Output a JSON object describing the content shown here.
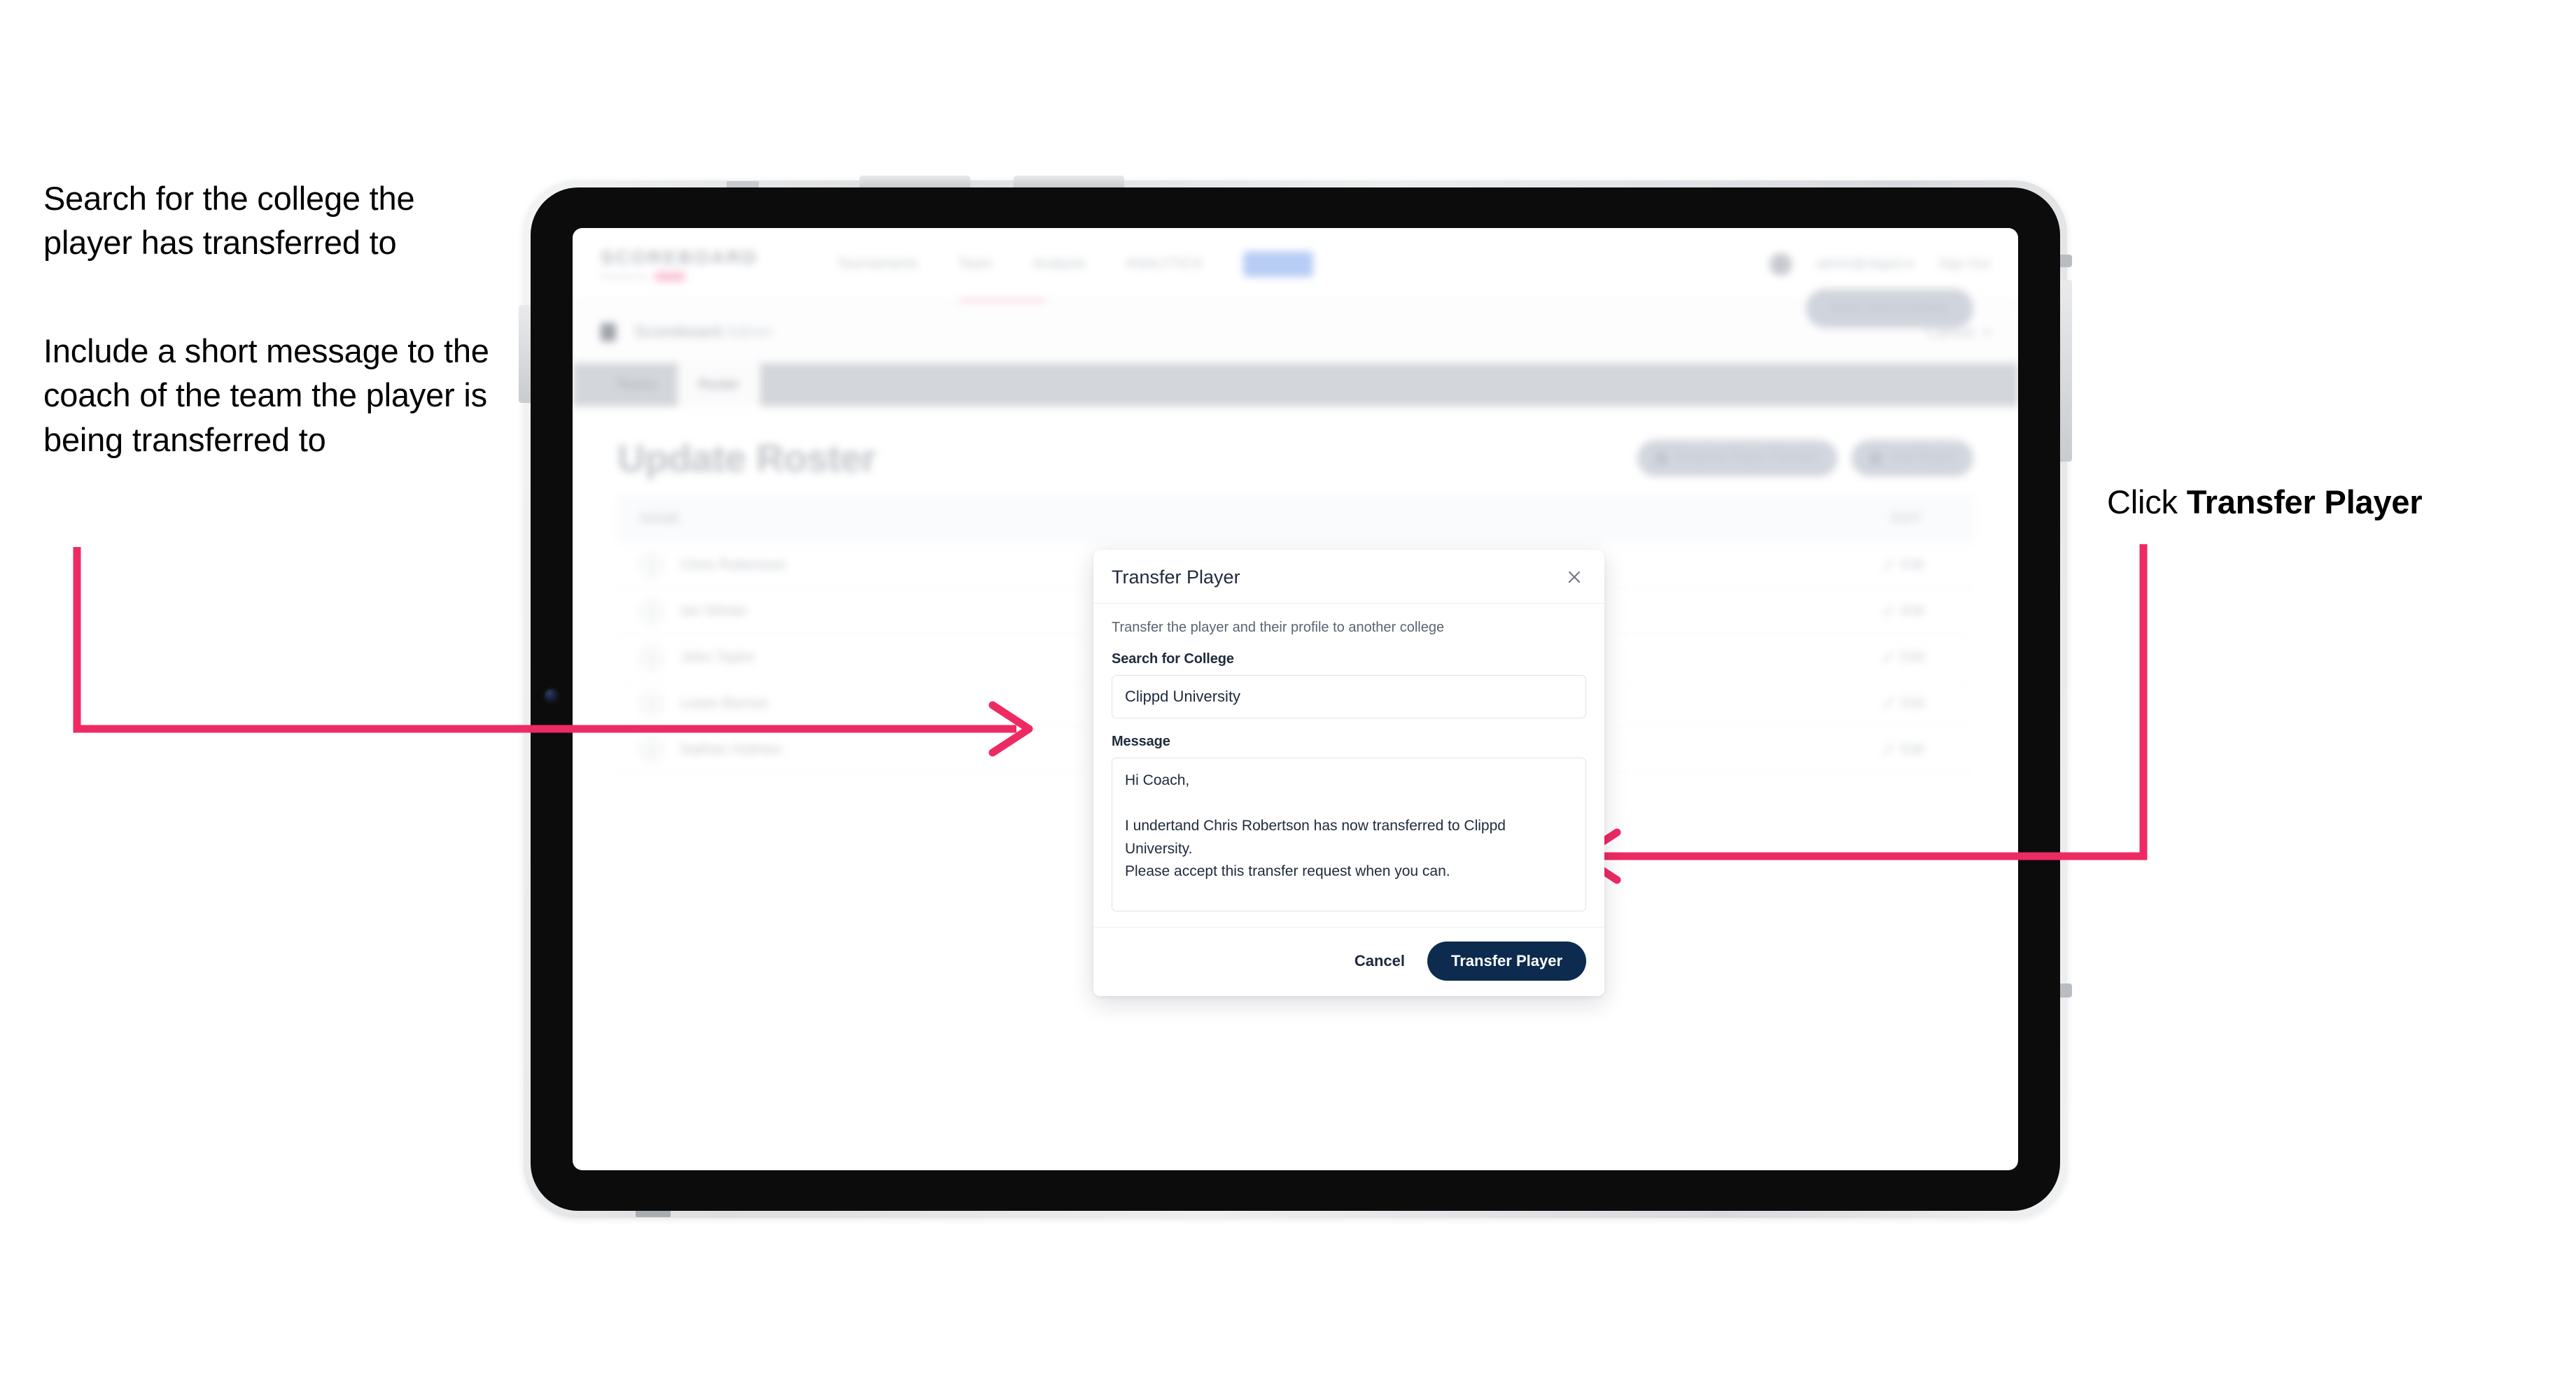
{
  "annotations": {
    "left_top": "Search for the college the player has transferred to",
    "left_bottom": "Include a short message to the coach of the team the player is being transferred to",
    "right_prefix": "Click ",
    "right_strong": "Transfer Player",
    "accent_color": "#ee2a63"
  },
  "app": {
    "brand": {
      "name": "SCOREBOARD",
      "sub": "Powered by"
    },
    "nav": [
      {
        "label": "Tournaments"
      },
      {
        "label": "Team"
      },
      {
        "label": "Analysis"
      },
      {
        "label": "ANALYTICS"
      },
      {
        "label": "Admin"
      }
    ],
    "header_right": {
      "account": "admin@clippd.io",
      "signout": "Sign Out"
    },
    "breadcrumb": {
      "title": "Scoreboard",
      "suffix": "Admin",
      "cancel": "Cancel",
      "chevron": "▾"
    },
    "tabs": [
      {
        "label": "Teams",
        "active": false
      },
      {
        "label": "Roster",
        "active": true
      }
    ],
    "page_title": "Update Roster",
    "page_actions": [
      {
        "label": "Request Player Transfer"
      },
      {
        "label": "Add Player"
      }
    ],
    "roster": {
      "columns": {
        "name": "NAME",
        "edit": "EDIT"
      },
      "rows": [
        {
          "name": "Chris Robertson",
          "action": "Edit"
        },
        {
          "name": "Ian Winter",
          "action": "Edit"
        },
        {
          "name": "John Taylor",
          "action": "Edit"
        },
        {
          "name": "Lewis Barnes",
          "action": "Edit"
        },
        {
          "name": "Nathan Holmes",
          "action": "Edit"
        }
      ]
    },
    "save_button": "Save And Continue"
  },
  "modal": {
    "title": "Transfer Player",
    "close_icon": "close-icon",
    "description": "Transfer the player and their profile to another college",
    "college_field": {
      "label": "Search for College",
      "value": "Clippd University",
      "placeholder": "Search for College"
    },
    "message_field": {
      "label": "Message",
      "value": "Hi Coach,\n\nI undertand Chris Robertson has now transferred to Clippd University.\nPlease accept this transfer request when you can.",
      "placeholder": "Message"
    },
    "cancel_label": "Cancel",
    "submit_label": "Transfer Player",
    "submit_color": "#0c2b4e"
  }
}
